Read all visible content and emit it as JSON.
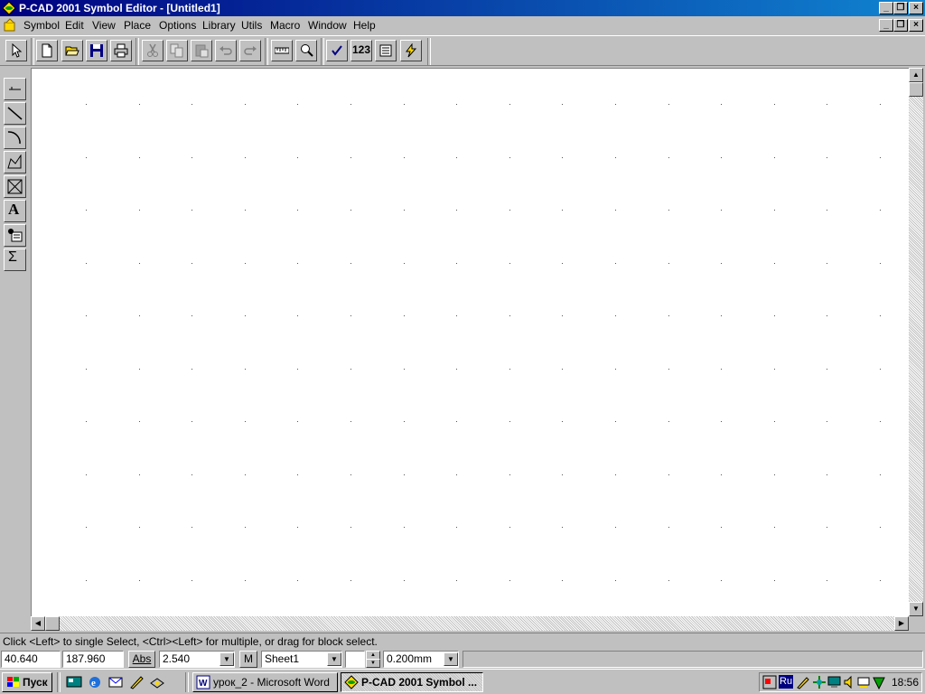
{
  "window": {
    "title": "P-CAD 2001 Symbol Editor - [Untitled1]",
    "controls": [
      "minimize",
      "restore",
      "close"
    ]
  },
  "menu": {
    "items": [
      {
        "label": "Symbol",
        "key": "S"
      },
      {
        "label": "Edit",
        "key": "E"
      },
      {
        "label": "View",
        "key": "V"
      },
      {
        "label": "Place",
        "key": "P"
      },
      {
        "label": "Options",
        "key": "O"
      },
      {
        "label": "Library",
        "key": "L"
      },
      {
        "label": "Utils",
        "key": "U"
      },
      {
        "label": "Macro",
        "key": "M"
      },
      {
        "label": "Window",
        "key": "W"
      },
      {
        "label": "Help",
        "key": "H"
      }
    ]
  },
  "toolbar": {
    "icons": [
      "select-arrow-icon",
      "new-file-icon",
      "open-folder-icon",
      "save-icon",
      "print-icon",
      "cut-icon",
      "copy-icon",
      "paste-icon",
      "undo-icon",
      "redo-icon",
      "measure-ruler-icon",
      "zoom-icon",
      "check-mark-icon",
      "numbering-icon",
      "library-icon",
      "lightning-icon"
    ],
    "numbering_label": "123"
  },
  "palette": {
    "icons": [
      "place-pin-icon",
      "place-line-icon",
      "place-arc-icon",
      "place-polygon-icon",
      "place-field-icon",
      "place-text-icon",
      "place-attribute-icon",
      "place-ref-point-icon"
    ],
    "text_tool_glyph": "A",
    "sum_glyph": "Σ"
  },
  "status": {
    "message": "Click <Left> to single Select, <Ctrl><Left> for multiple, or drag for block select.",
    "x_coord": "40.640",
    "y_coord": "187.960",
    "abs_label": "Abs",
    "grid_value": "2.540",
    "m_label": "M",
    "sheet": "Sheet1",
    "line_width": "0.200mm"
  },
  "taskbar": {
    "start_label": "Пуск",
    "tasks": [
      {
        "label": "урок_2 - Microsoft Word",
        "active": false
      },
      {
        "label": "P-CAD 2001 Symbol ...",
        "active": true
      }
    ],
    "tray_lang": "Ru",
    "clock": "18:56"
  },
  "colors": {
    "title_start": "#000080",
    "title_end": "#1084d0",
    "chrome": "#c0c0c0",
    "canvas": "#ffffff",
    "grid_dot": "#555555"
  }
}
